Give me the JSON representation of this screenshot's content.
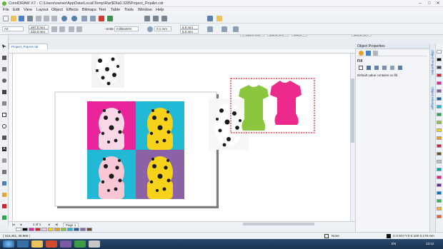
{
  "window": {
    "title": "CorelDRAW X7 - C:\\Users\\owner\\AppData\\Local\\Temp\\Rar$DIa0.328\\Project_PopArt.cdr",
    "minimize": "–",
    "maximize": "□",
    "close": "✕"
  },
  "menu": [
    "File",
    "Edit",
    "View",
    "Layout",
    "Object",
    "Effects",
    "Bitmaps",
    "Text",
    "Table",
    "Tools",
    "Window",
    "Help"
  ],
  "toolbar": {
    "zoom": "62%",
    "snap_to": "Snap To",
    "x": "X:  148,5 mm",
    "y": "Y:  105,0 mm",
    "w1": "0,0 mm",
    "h1": "100,0 mm",
    "pct1": "100,0",
    "pct2": "100,0",
    "pct_unit": "%",
    "w2": "148,5 mm",
    "h2": "105,0 mm",
    "angle": "0,0",
    "nudge_a": "5,0 mm",
    "nudge_b": "5,0 mm"
  },
  "propbar": {
    "page_size": "A4",
    "page_w": "297,0 mm",
    "page_h": "210,0 mm",
    "units_label": "Units:",
    "units": "millimeters",
    "nudge": "0,1 mm",
    "dup_x": "5,0 mm",
    "dup_y": "5,0 mm"
  },
  "document_tab": "Project_PopArt.cdr",
  "pagebar": {
    "page_count": "1 of 1",
    "page_tab": "Page 1"
  },
  "status": {
    "coords": "( 315,461; 38,968 )",
    "fill": "None",
    "outline": "C:0 M:0 Y:0 K:100  0,176 mm"
  },
  "docker": {
    "title": "Object Properties",
    "section": "Fill",
    "message": "Default value contains no fill."
  },
  "side_tabs": [
    "Object Properties",
    "Object Manager"
  ],
  "taskbar": {
    "time": "13:12",
    "lang": "EN"
  },
  "colors": {
    "popart_magenta": "#e9239a",
    "popart_cyan": "#22b9d6",
    "popart_yellow": "#f6d21a",
    "popart_purple": "#8b62a6",
    "shirt_green": "#8cc63f",
    "shirt_pink": "#ec2a8c",
    "selection_red": "#d62b2b"
  },
  "palette": [
    "#ffffff",
    "#000000",
    "#e9239a",
    "#d9212b",
    "#f9c6d4",
    "#f6d21a",
    "#f39a1e",
    "#8cc63f",
    "#22b9d6",
    "#1f5aa6",
    "#8b62a6",
    "#6b4a2a"
  ],
  "right_palette": [
    "#ffffff",
    "#000000",
    "#4d4d4d",
    "#d9212b",
    "#e9239a",
    "#8b62a6",
    "#1f5aa6",
    "#22b9d6",
    "#29a84a",
    "#8cc63f",
    "#f6d21a",
    "#f39a1e",
    "#c1272d",
    "#6b4a2a",
    "#bfbfbf",
    "#00a99d",
    "#ed1e79",
    "#662d91",
    "#0071bc",
    "#39b54a",
    "#fbb03b",
    "#f15a24"
  ]
}
